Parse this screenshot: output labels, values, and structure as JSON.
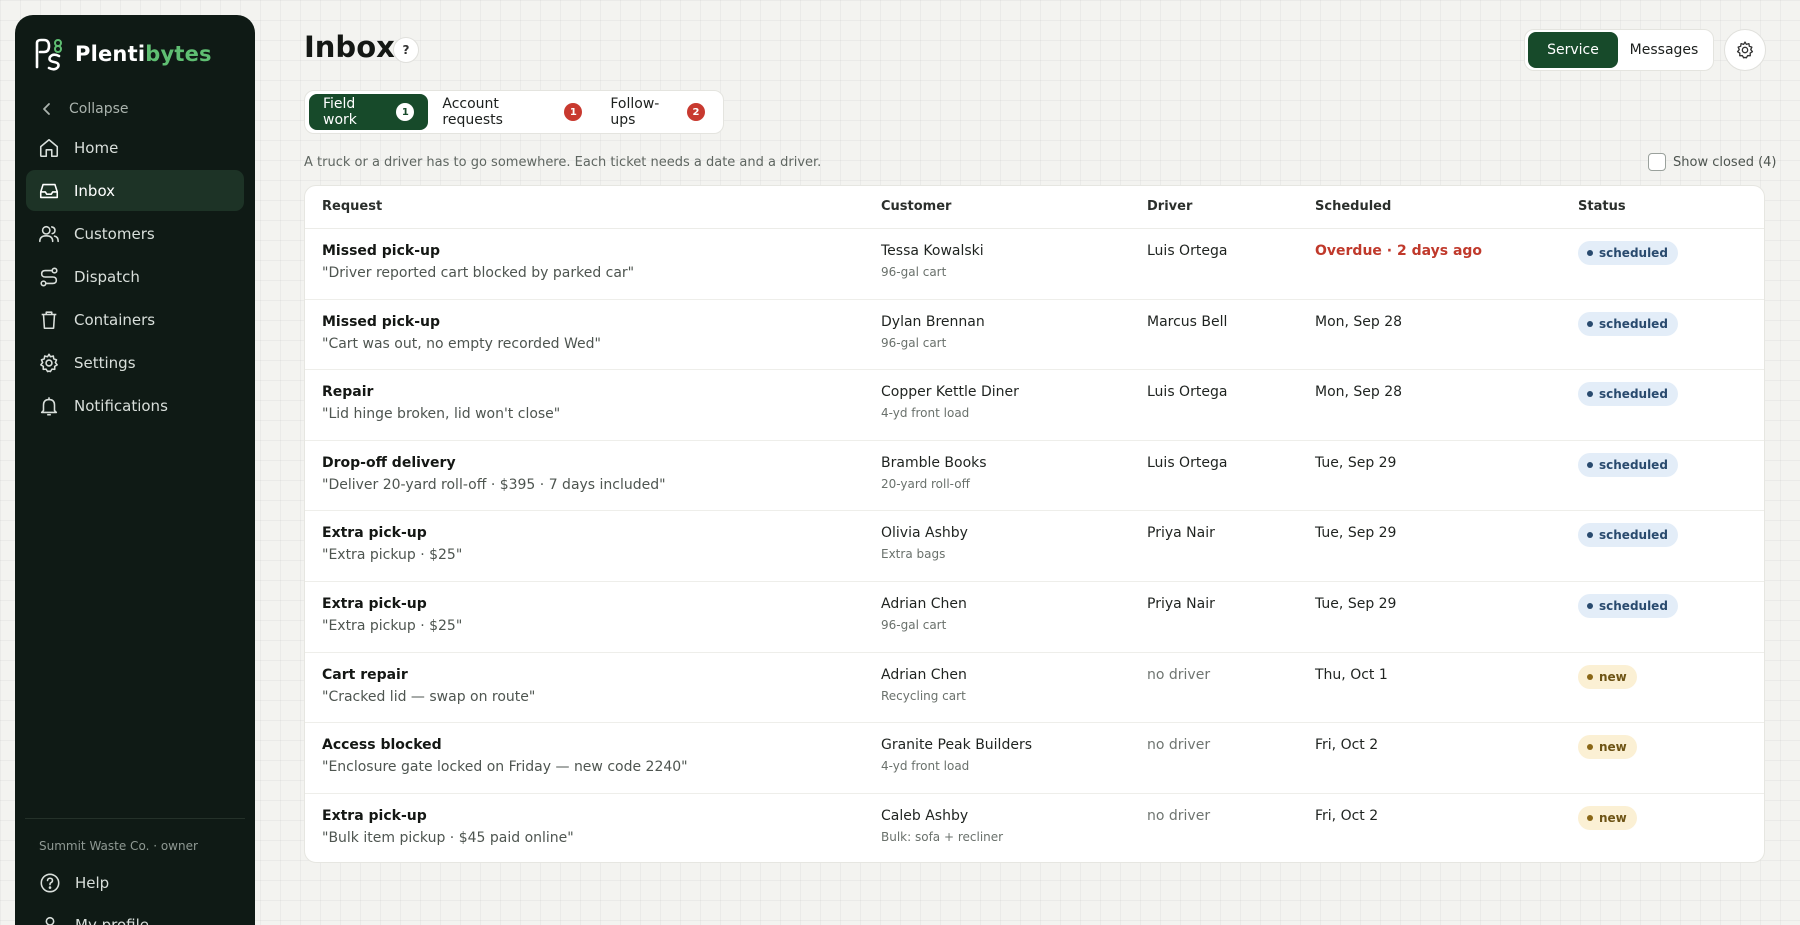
{
  "brand": {
    "name_main": "Plenti",
    "name_accent": "bytes",
    "accent_color": "#5fbf72"
  },
  "sidebar": {
    "collapse_label": "Collapse",
    "items": [
      {
        "label": "Home",
        "icon": "home-icon"
      },
      {
        "label": "Inbox",
        "icon": "inbox-icon",
        "active": true
      },
      {
        "label": "Customers",
        "icon": "users-icon"
      },
      {
        "label": "Dispatch",
        "icon": "route-icon"
      },
      {
        "label": "Containers",
        "icon": "trash-bin-icon"
      },
      {
        "label": "Settings",
        "icon": "gear-icon"
      },
      {
        "label": "Notifications",
        "icon": "bell-icon"
      }
    ],
    "org_label": "Summit Waste Co. · owner",
    "help_label": "Help",
    "profile_label": "My profile"
  },
  "header": {
    "title": "Inbox",
    "help_badge": "?",
    "modes": {
      "active": "Service",
      "other": "Messages"
    }
  },
  "tabs": [
    {
      "label": "Field work",
      "count": "1",
      "active": true
    },
    {
      "label": "Account requests",
      "count": "1"
    },
    {
      "label": "Follow-ups",
      "count": "2"
    }
  ],
  "subtitle": "A truck or a driver has to go somewhere. Each ticket needs a date and a driver.",
  "show_closed_label": "Show closed (4)",
  "table": {
    "headers": {
      "request": "Request",
      "customer": "Customer",
      "driver": "Driver",
      "scheduled": "Scheduled",
      "status": "Status"
    },
    "rows": [
      {
        "title": "Missed pick-up",
        "note": "\"Driver reported cart blocked by parked car\"",
        "customer": "Tessa Kowalski",
        "container": "96-gal cart",
        "driver": "Luis Ortega",
        "scheduled": "Overdue · 2 days ago",
        "status": "scheduled"
      },
      {
        "title": "Missed pick-up",
        "note": "\"Cart was out, no empty recorded Wed\"",
        "customer": "Dylan Brennan",
        "container": "96-gal cart",
        "driver": "Marcus Bell",
        "scheduled": "Mon, Sep 28",
        "status": "scheduled"
      },
      {
        "title": "Repair",
        "note": "\"Lid hinge broken, lid won't close\"",
        "customer": "Copper Kettle Diner",
        "container": "4-yd front load",
        "driver": "Luis Ortega",
        "scheduled": "Mon, Sep 28",
        "status": "scheduled"
      },
      {
        "title": "Drop-off delivery",
        "note": "\"Deliver 20-yard roll-off · $395 · 7 days included\"",
        "customer": "Bramble Books",
        "container": "20-yard roll-off",
        "driver": "Luis Ortega",
        "scheduled": "Tue, Sep 29",
        "status": "scheduled"
      },
      {
        "title": "Extra pick-up",
        "note": "\"Extra pickup · $25\"",
        "customer": "Olivia Ashby",
        "container": "Extra bags",
        "driver": "Priya Nair",
        "scheduled": "Tue, Sep 29",
        "status": "scheduled"
      },
      {
        "title": "Extra pick-up",
        "note": "\"Extra pickup · $25\"",
        "customer": "Adrian Chen",
        "container": "96-gal cart",
        "driver": "Priya Nair",
        "scheduled": "Tue, Sep 29",
        "status": "scheduled"
      },
      {
        "title": "Cart repair",
        "note": "\"Cracked lid — swap on route\"",
        "customer": "Adrian Chen",
        "container": "Recycling cart",
        "driver": "no driver",
        "scheduled": "Thu, Oct 1",
        "status": "new"
      },
      {
        "title": "Access blocked",
        "note": "\"Enclosure gate locked on Friday — new code 2240\"",
        "customer": "Granite Peak Builders",
        "container": "4-yd front load",
        "driver": "no driver",
        "scheduled": "Fri, Oct 2",
        "status": "new"
      },
      {
        "title": "Extra pick-up",
        "note": "\"Bulk item pickup · $45 paid online\"",
        "customer": "Caleb Ashby",
        "container": "Bulk: sofa + recliner",
        "driver": "no driver",
        "scheduled": "Fri, Oct 2",
        "status": "new"
      }
    ]
  },
  "colors": {
    "primary": "#174a2a",
    "sidebar_bg": "#0f1a15",
    "overdue": "#c0392b",
    "badge_red": "#c8392f"
  }
}
